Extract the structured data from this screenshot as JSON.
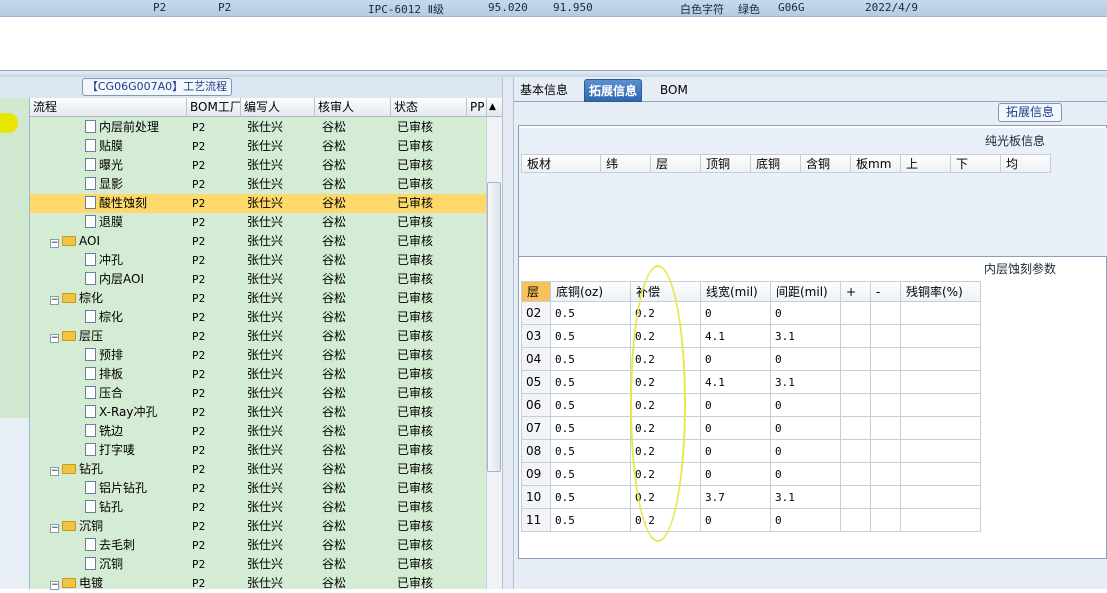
{
  "topbar": {
    "f1": "P2",
    "f2": "P2",
    "f3": "IPC-6012 Ⅱ级",
    "f4": "95.020",
    "f5": "91.950",
    "f6": "白色字符",
    "f7": "绿色",
    "f8": "G06G",
    "f9": "2022/4/9"
  },
  "process_title": "【CG06G007A0】工艺流程",
  "grid": {
    "headers": [
      "流程",
      "BOM工厂",
      "编写人",
      "核审人",
      "状态",
      "PP"
    ],
    "rows": [
      {
        "name": "内层前处理",
        "type": "doc",
        "bom": "P2",
        "writer": "张仕兴",
        "reviewer": "谷松",
        "status": "已审核"
      },
      {
        "name": "贴膜",
        "type": "doc",
        "bom": "P2",
        "writer": "张仕兴",
        "reviewer": "谷松",
        "status": "已审核"
      },
      {
        "name": "曝光",
        "type": "doc",
        "bom": "P2",
        "writer": "张仕兴",
        "reviewer": "谷松",
        "status": "已审核"
      },
      {
        "name": "显影",
        "type": "doc",
        "bom": "P2",
        "writer": "张仕兴",
        "reviewer": "谷松",
        "status": "已审核"
      },
      {
        "name": "酸性蚀刻",
        "type": "doc",
        "bom": "P2",
        "writer": "张仕兴",
        "reviewer": "谷松",
        "status": "已审核",
        "selected": true
      },
      {
        "name": "退膜",
        "type": "doc",
        "bom": "P2",
        "writer": "张仕兴",
        "reviewer": "谷松",
        "status": "已审核"
      },
      {
        "name": "AOI",
        "type": "folder",
        "bom": "P2",
        "writer": "张仕兴",
        "reviewer": "谷松",
        "status": "已审核"
      },
      {
        "name": "冲孔",
        "type": "doc",
        "bom": "P2",
        "writer": "张仕兴",
        "reviewer": "谷松",
        "status": "已审核"
      },
      {
        "name": "内层AOI",
        "type": "doc",
        "bom": "P2",
        "writer": "张仕兴",
        "reviewer": "谷松",
        "status": "已审核"
      },
      {
        "name": "棕化",
        "type": "folder",
        "bom": "P2",
        "writer": "张仕兴",
        "reviewer": "谷松",
        "status": "已审核"
      },
      {
        "name": "棕化",
        "type": "doc",
        "bom": "P2",
        "writer": "张仕兴",
        "reviewer": "谷松",
        "status": "已审核"
      },
      {
        "name": "层压",
        "type": "folder",
        "bom": "P2",
        "writer": "张仕兴",
        "reviewer": "谷松",
        "status": "已审核"
      },
      {
        "name": "预排",
        "type": "doc",
        "bom": "P2",
        "writer": "张仕兴",
        "reviewer": "谷松",
        "status": "已审核"
      },
      {
        "name": "排板",
        "type": "doc",
        "bom": "P2",
        "writer": "张仕兴",
        "reviewer": "谷松",
        "status": "已审核"
      },
      {
        "name": "压合",
        "type": "doc",
        "bom": "P2",
        "writer": "张仕兴",
        "reviewer": "谷松",
        "status": "已审核"
      },
      {
        "name": "X-Ray冲孔",
        "type": "doc",
        "bom": "P2",
        "writer": "张仕兴",
        "reviewer": "谷松",
        "status": "已审核"
      },
      {
        "name": "铣边",
        "type": "doc",
        "bom": "P2",
        "writer": "张仕兴",
        "reviewer": "谷松",
        "status": "已审核"
      },
      {
        "name": "打字唛",
        "type": "doc",
        "bom": "P2",
        "writer": "张仕兴",
        "reviewer": "谷松",
        "status": "已审核"
      },
      {
        "name": "钻孔",
        "type": "folder",
        "bom": "P2",
        "writer": "张仕兴",
        "reviewer": "谷松",
        "status": "已审核"
      },
      {
        "name": "铝片钻孔",
        "type": "doc",
        "bom": "P2",
        "writer": "张仕兴",
        "reviewer": "谷松",
        "status": "已审核"
      },
      {
        "name": "钻孔",
        "type": "doc",
        "bom": "P2",
        "writer": "张仕兴",
        "reviewer": "谷松",
        "status": "已审核"
      },
      {
        "name": "沉铜",
        "type": "folder",
        "bom": "P2",
        "writer": "张仕兴",
        "reviewer": "谷松",
        "status": "已审核"
      },
      {
        "name": "去毛刺",
        "type": "doc",
        "bom": "P2",
        "writer": "张仕兴",
        "reviewer": "谷松",
        "status": "已审核"
      },
      {
        "name": "沉铜",
        "type": "doc",
        "bom": "P2",
        "writer": "张仕兴",
        "reviewer": "谷松",
        "status": "已审核"
      },
      {
        "name": "电镀",
        "type": "folder",
        "bom": "P2",
        "writer": "张仕兴",
        "reviewer": "谷松",
        "status": "已审核"
      }
    ]
  },
  "tabs": [
    "基本信息",
    "拓展信息",
    "BOM"
  ],
  "active_tab": 1,
  "ext_label": "拓展信息",
  "section1": {
    "title": "纯光板信息",
    "headers": [
      "板材",
      "纬",
      "层",
      "顶铜",
      "底铜",
      "含铜",
      "板mm",
      "上",
      "下",
      "均"
    ]
  },
  "section2": {
    "title": "内层蚀刻参数",
    "headers": [
      "层",
      "底铜(oz)",
      "补偿",
      "线宽(mil)",
      "间距(mil)",
      "+",
      "-",
      "残铜率(%)"
    ],
    "rows": [
      [
        "02",
        "0.5",
        "0.2",
        "0",
        "0",
        "",
        "",
        ""
      ],
      [
        "03",
        "0.5",
        "0.2",
        "4.1",
        "3.1",
        "",
        "",
        ""
      ],
      [
        "04",
        "0.5",
        "0.2",
        "0",
        "0",
        "",
        "",
        ""
      ],
      [
        "05",
        "0.5",
        "0.2",
        "4.1",
        "3.1",
        "",
        "",
        ""
      ],
      [
        "06",
        "0.5",
        "0.2",
        "0",
        "0",
        "",
        "",
        ""
      ],
      [
        "07",
        "0.5",
        "0.2",
        "0",
        "0",
        "",
        "",
        ""
      ],
      [
        "08",
        "0.5",
        "0.2",
        "0",
        "0",
        "",
        "",
        ""
      ],
      [
        "09",
        "0.5",
        "0.2",
        "0",
        "0",
        "",
        "",
        ""
      ],
      [
        "10",
        "0.5",
        "0.2",
        "3.7",
        "3.1",
        "",
        "",
        ""
      ],
      [
        "11",
        "0.5",
        "0.2",
        "0",
        "0",
        "",
        "",
        ""
      ]
    ]
  },
  "colors": {
    "selected_row": "#ffd86a",
    "grid_bg": "#d4ebd4",
    "tab_active": "#2f66b0",
    "annotation": "#e8e84a"
  }
}
